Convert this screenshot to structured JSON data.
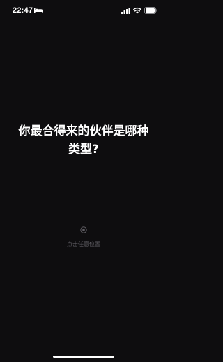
{
  "status_bar": {
    "time": "22:47",
    "icons": [
      "bed-icon",
      "signal-icon",
      "wifi-icon",
      "battery-icon"
    ]
  },
  "main": {
    "question": "你最合得来的伙伴是哪种类型?",
    "tap_hint": "点击任意位置"
  },
  "colors": {
    "background": "#0e0d0f",
    "text": "#ffffff",
    "hint": "#5f5d63"
  }
}
